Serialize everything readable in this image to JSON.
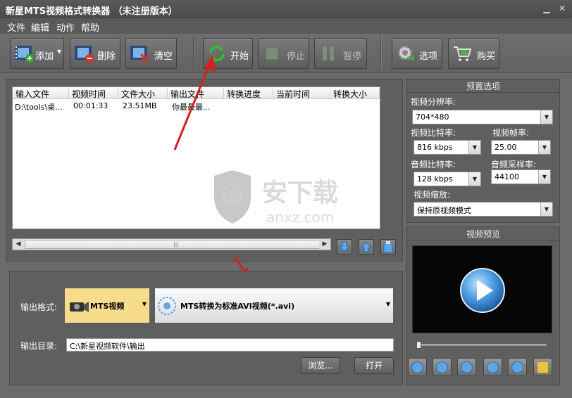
{
  "window": {
    "title": "新星MTS视频格式转换器 （未注册版本）"
  },
  "menu": {
    "items": [
      "文件",
      "编辑",
      "动作",
      "帮助"
    ]
  },
  "toolbar": {
    "add": "添加",
    "delete": "删除",
    "clear": "清空",
    "start": "开始",
    "stop": "停止",
    "pause": "暂停",
    "options": "选项",
    "buy": "购买"
  },
  "file_list": {
    "columns": [
      "输入文件",
      "视频时间",
      "文件大小",
      "输出文件",
      "转换进度",
      "当前时间",
      "转换大小"
    ],
    "rows": [
      {
        "input": "D:\\tools\\桌...",
        "duration": "00:01:33",
        "size": "23.51MB",
        "output": "你最最最...",
        "progress": "",
        "current": "",
        "converted_size": ""
      }
    ]
  },
  "preset": {
    "title": "预置选项",
    "resolution_label": "视频分辨率:",
    "resolution": "704*480",
    "video_bitrate_label": "视频比特率:",
    "video_bitrate": "816 kbps",
    "framerate_label": "视频帧率:",
    "framerate": "25.00",
    "audio_bitrate_label": "音频比特率:",
    "audio_bitrate": "128 kbps",
    "samplerate_label": "音频采样率:",
    "samplerate": "44100",
    "scale_label": "视频缩放:",
    "scale": "保持原视频模式"
  },
  "preview": {
    "title": "视频预览"
  },
  "output": {
    "format_label": "输出格式:",
    "format_category": "MTS视频",
    "format_value": "MTS转换为标准AVI视频(*.avi)",
    "dir_label": "输出目录:",
    "dir_value": "C:\\新星视频软件\\输出",
    "browse": "浏览...",
    "open": "打开"
  },
  "watermark": {
    "brand": "安下载",
    "url": "anxz.com"
  },
  "colors": {
    "accent_blue": "#4a9be0",
    "format_highlight": "#f7dc8c",
    "arrow_red": "#d42020"
  }
}
